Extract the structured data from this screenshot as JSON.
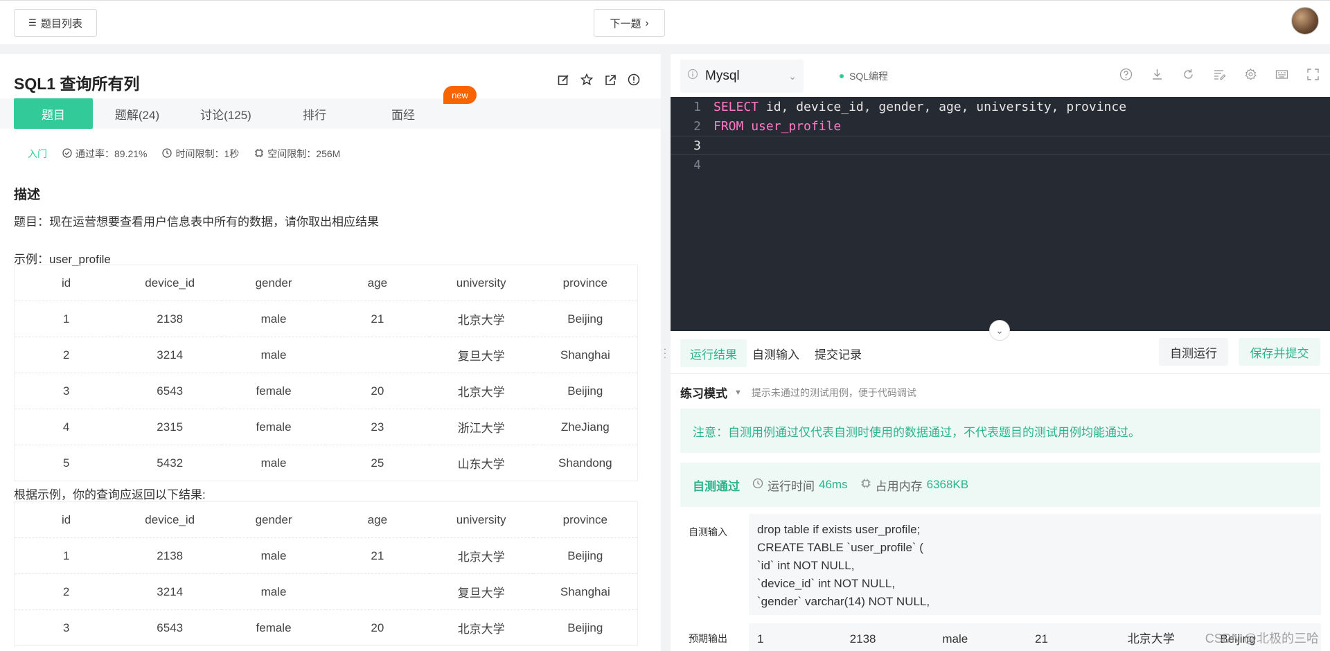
{
  "topbar": {
    "list_label": "题目列表",
    "next_label": "下一题"
  },
  "problem": {
    "title": "SQL1  查询所有列",
    "tabs": [
      "题目",
      "题解(24)",
      "讨论(125)",
      "排行",
      "面经"
    ],
    "new_badge": "new",
    "level": "入门",
    "pass_rate": "通过率：89.21%",
    "time_limit": "时间限制：1秒",
    "space_limit": "空间限制：256M",
    "desc_heading": "描述",
    "desc_text": "题目：现在运营想要查看用户信息表中所有的数据，请你取出相应结果",
    "example_label": "示例：user_profile",
    "result_label": "根据示例，你的查询应返回以下结果:",
    "table_headers": [
      "id",
      "device_id",
      "gender",
      "age",
      "university",
      "province"
    ],
    "table_rows": [
      [
        "1",
        "2138",
        "male",
        "21",
        "北京大学",
        "Beijing"
      ],
      [
        "2",
        "3214",
        "male",
        "",
        "复旦大学",
        "Shanghai"
      ],
      [
        "3",
        "6543",
        "female",
        "20",
        "北京大学",
        "Beijing"
      ],
      [
        "4",
        "2315",
        "female",
        "23",
        "浙江大学",
        "ZheJiang"
      ],
      [
        "5",
        "5432",
        "male",
        "25",
        "山东大学",
        "Shandong"
      ]
    ],
    "result_rows": [
      [
        "1",
        "2138",
        "male",
        "21",
        "北京大学",
        "Beijing"
      ],
      [
        "2",
        "3214",
        "male",
        "",
        "复旦大学",
        "Shanghai"
      ],
      [
        "3",
        "6543",
        "female",
        "20",
        "北京大学",
        "Beijing"
      ]
    ]
  },
  "editor": {
    "language": "Mysql",
    "mode": "SQL编程",
    "lines": [
      {
        "num": "1",
        "kw": "SELECT",
        "rest": " id, device_id, gender, age, university, province"
      },
      {
        "num": "2",
        "kw": "FROM",
        "rest": " user_profile"
      },
      {
        "num": "3",
        "kw": "",
        "rest": ""
      },
      {
        "num": "4",
        "kw": "",
        "rest": ""
      }
    ]
  },
  "run_panel": {
    "tabs": [
      "运行结果",
      "自测输入",
      "提交记录"
    ],
    "run_label": "自测运行",
    "submit_label": "保存并提交",
    "practice_mode": "练习模式",
    "practice_hint": "提示未通过的测试用例，便于代码调试",
    "notice": "注意：自测用例通过仅代表自测时使用的数据通过，不代表题目的测试用例均能通过。",
    "status": "自测通过",
    "runtime_label": "运行时间",
    "runtime_value": "46ms",
    "memory_label": "占用内存",
    "memory_value": "6368KB",
    "input_label": "自测输入",
    "input_lines": [
      "drop table if exists user_profile;",
      "CREATE TABLE `user_profile` (",
      "`id` int NOT NULL,",
      "`device_id` int NOT NULL,",
      "`gender` varchar(14) NOT NULL,"
    ],
    "expected_label": "预期输出",
    "expected_row": [
      "1",
      "2138",
      "male",
      "21",
      "北京大学",
      "Beijing"
    ]
  },
  "watermark": "CSDN @北极的三哈"
}
